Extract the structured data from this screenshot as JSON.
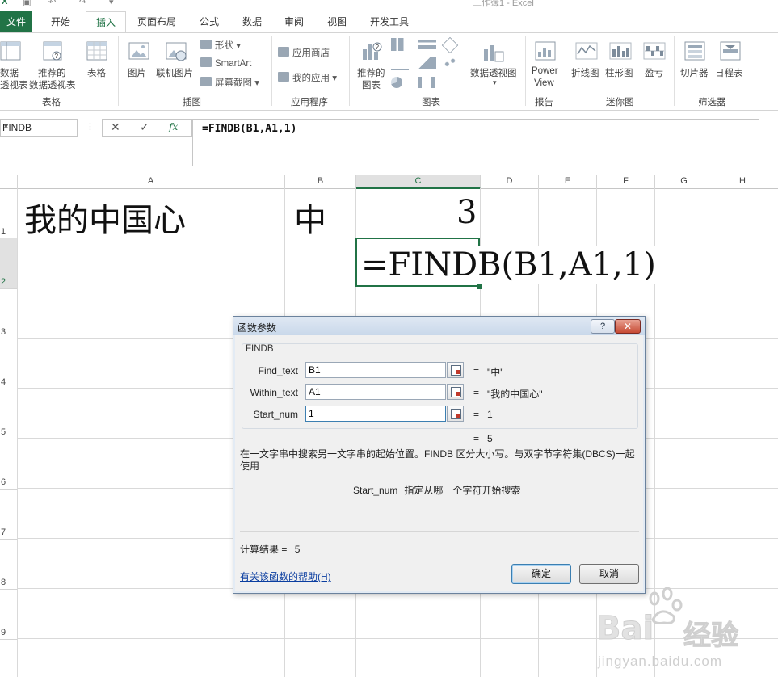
{
  "window": {
    "title": "工作簿1 - Excel"
  },
  "tabs": [
    "文件",
    "开始",
    "插入",
    "页面布局",
    "公式",
    "数据",
    "审阅",
    "视图",
    "开发工具"
  ],
  "ribbon": {
    "groups": {
      "tables": "表格",
      "illustrations": "插图",
      "apps": "应用程序",
      "charts": "图表",
      "reports": "报告",
      "sparklines": "迷你图",
      "filters": "筛选器"
    },
    "buttons": {
      "pivot_line1": "数据",
      "pivot_line2": "透视表",
      "rec_pivot_line1": "推荐的",
      "rec_pivot_line2": "数据透视表",
      "table": "表格",
      "pictures": "图片",
      "online_pictures": "联机图片",
      "shapes": "形状",
      "smartart": "SmartArt",
      "screenshot": "屏幕截图",
      "store": "应用商店",
      "my_apps": "我的应用",
      "rec_charts_line1": "推荐的",
      "rec_charts_line2": "图表",
      "pivot_chart": "数据透视图",
      "power_view_line1": "Power",
      "power_view_line2": "View",
      "line": "折线图",
      "column": "柱形图",
      "winloss": "盈亏",
      "slicer": "切片器",
      "timeline": "日程表"
    }
  },
  "formula_bar": {
    "name_box": "FINDB",
    "formula": "=FINDB(B1,A1,1)"
  },
  "grid": {
    "columns": [
      "A",
      "B",
      "C",
      "D",
      "E",
      "F",
      "G",
      "H"
    ],
    "rows": [
      "1",
      "2",
      "3",
      "4",
      "5",
      "6",
      "7",
      "8",
      "9"
    ],
    "cells": {
      "A1": "我的中国心",
      "B1": "中",
      "C1": "3",
      "C2": "=FINDB(B1,A1,1)"
    }
  },
  "dialog": {
    "title": "函数参数",
    "help_btn": "?",
    "close_btn": "✕",
    "function_name": "FINDB",
    "args": [
      {
        "label": "Find_text",
        "value": "B1",
        "result": "\"中\""
      },
      {
        "label": "Within_text",
        "value": "A1",
        "result": "\"我的中国心\""
      },
      {
        "label": "Start_num",
        "value": "1",
        "result": "1"
      }
    ],
    "formula_result": "5",
    "description": "在一文字串中搜索另一文字串的起始位置。FINDB 区分大小写。与双字节字符集(DBCS)一起使用",
    "param_name": "Start_num",
    "param_description": "指定从哪一个字符开始搜索",
    "result_label": "计算结果 =",
    "result_value": "5",
    "help_link": "有关该函数的帮助(H)",
    "ok": "确定",
    "cancel": "取消"
  },
  "watermark": {
    "brand": "Bai",
    "brand2": "经验",
    "url": "jingyan.baidu.com"
  }
}
